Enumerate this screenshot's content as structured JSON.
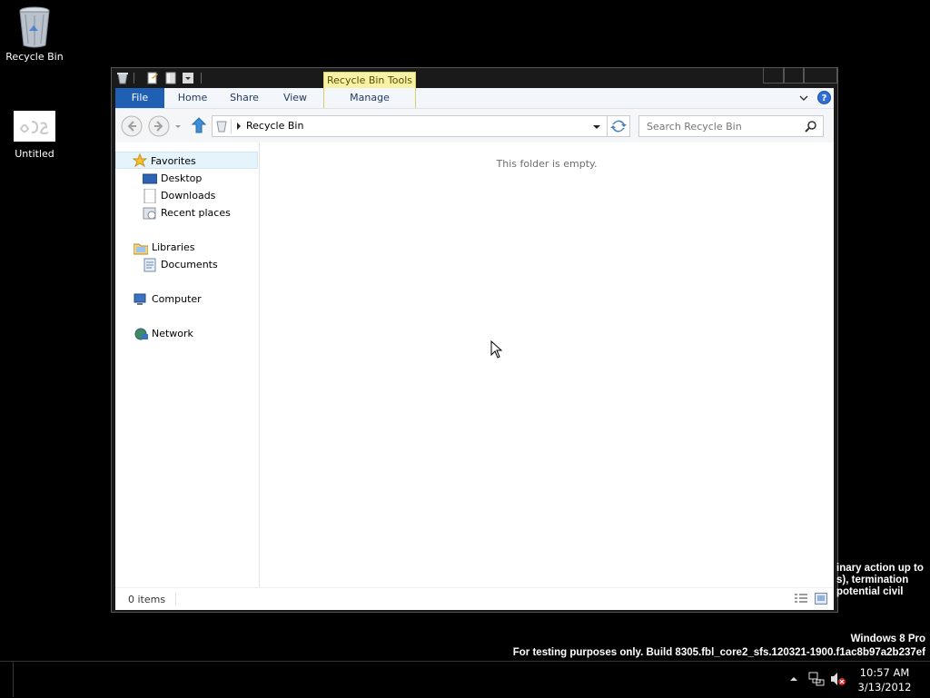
{
  "desktop": {
    "icons": [
      {
        "label": "Recycle Bin"
      },
      {
        "label": "Untitled"
      }
    ],
    "watermark": {
      "line1": "Windows 8 Pro",
      "line2": "For testing purposes only. Build 8305.fbl_core2_sfs.120321-1900.f1ac8b97a2b237ef"
    },
    "partial_notice": [
      "inary action up to",
      "s), termination",
      "potential civil"
    ]
  },
  "window": {
    "contextual_tab_group": "Recycle Bin Tools",
    "ribbon_tabs": {
      "file": "File",
      "home": "Home",
      "share": "Share",
      "view": "View",
      "manage": "Manage"
    },
    "address": {
      "path": "Recycle Bin"
    },
    "search": {
      "placeholder": "Search Recycle Bin"
    },
    "nav": {
      "favorites": "Favorites",
      "desktop": "Desktop",
      "downloads": "Downloads",
      "recent": "Recent places",
      "libraries": "Libraries",
      "documents": "Documents",
      "computer": "Computer",
      "network": "Network"
    },
    "empty_message": "This folder is empty.",
    "status": {
      "items": "0 items"
    }
  },
  "taskbar": {
    "time": "10:57 AM",
    "date": "3/13/2012"
  },
  "colors": {
    "file_tab": "#1f5fb4",
    "contextual_tab": "#f7f2a6",
    "nav_selected": "#e5f3fb"
  }
}
